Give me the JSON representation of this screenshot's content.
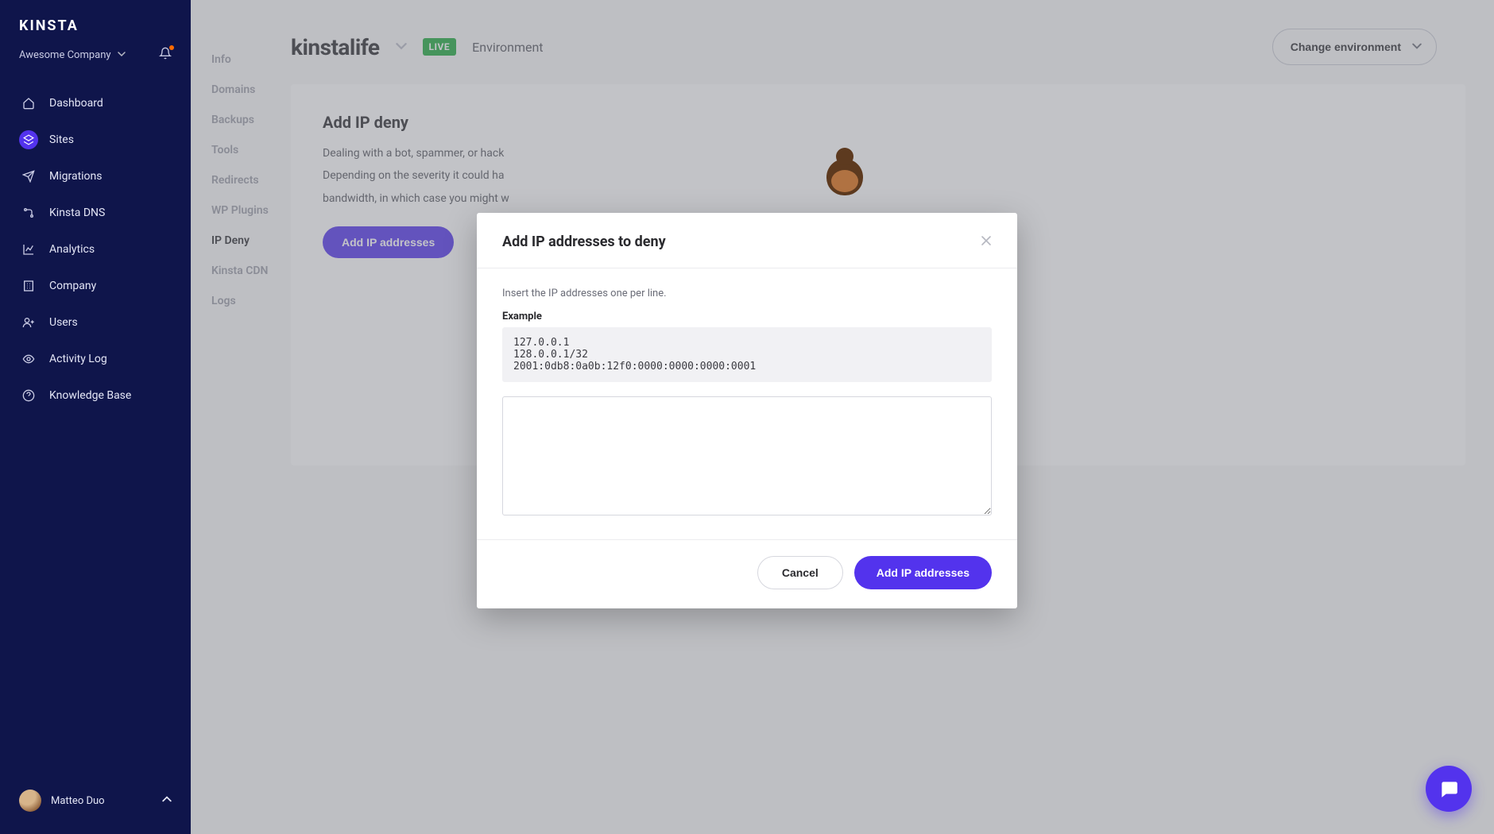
{
  "brand": "KINSTA",
  "company": {
    "name": "Awesome Company"
  },
  "sidebar": {
    "items": [
      {
        "label": "Dashboard"
      },
      {
        "label": "Sites"
      },
      {
        "label": "Migrations"
      },
      {
        "label": "Kinsta DNS"
      },
      {
        "label": "Analytics"
      },
      {
        "label": "Company"
      },
      {
        "label": "Users"
      },
      {
        "label": "Activity Log"
      },
      {
        "label": "Knowledge Base"
      }
    ],
    "active_index": 1
  },
  "user": {
    "name": "Matteo Duo"
  },
  "site": {
    "name": "kinstalife",
    "env_badge": "LIVE",
    "env_label": "Environment",
    "change_env_label": "Change environment"
  },
  "subnav": {
    "items": [
      {
        "label": "Info"
      },
      {
        "label": "Domains"
      },
      {
        "label": "Backups"
      },
      {
        "label": "Tools"
      },
      {
        "label": "Redirects"
      },
      {
        "label": "WP Plugins"
      },
      {
        "label": "IP Deny"
      },
      {
        "label": "Kinsta CDN"
      },
      {
        "label": "Logs"
      }
    ],
    "active_index": 6
  },
  "page": {
    "title": "Add IP deny",
    "desc_line1": "Dealing with a bot, spammer, or hack",
    "desc_line2": "Depending on the severity it could ha",
    "desc_line3": "bandwidth, in which case you might w",
    "primary_button": "Add IP addresses"
  },
  "modal": {
    "title": "Add IP addresses to deny",
    "hint": "Insert the IP addresses one per line.",
    "example_label": "Example",
    "example_text": "127.0.0.1\n128.0.0.1/32\n2001:0db8:0a0b:12f0:0000:0000:0000:0001",
    "textarea_value": "",
    "cancel_label": "Cancel",
    "confirm_label": "Add IP addresses"
  }
}
